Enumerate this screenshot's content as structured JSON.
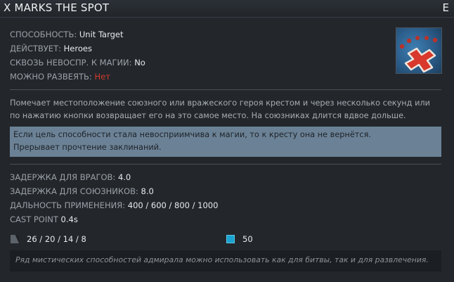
{
  "ability": {
    "title": "X MARKS THE SPOT",
    "hotkey": "E",
    "icon": "x-marks-the-spot-icon"
  },
  "stats": [
    {
      "label": "СПОСОБНОСТЬ: ",
      "value": "Unit Target"
    },
    {
      "label": "ДЕЙСТВУЕТ: ",
      "value": "Heroes"
    },
    {
      "label": "СКВОЗЬ НЕВОСПР. К МАГИИ: ",
      "value": "No"
    },
    {
      "label": "МОЖНО РАЗВЕЯТЬ: ",
      "value": "Нет"
    }
  ],
  "description": "Помечает местоположение союзного или вражеского героя крестом и через несколько секунд или по нажатию кнопки возвращает его на это самое место. На союзниках длится вдвое дольше.",
  "notes": [
    "Если цель способности стала невосприимчива к магии, то к кресту она не вернётся.",
    "Прерывает прочтение заклинаний."
  ],
  "values": [
    {
      "label": "ЗАДЕРЖКА ДЛЯ ВРАГОВ: ",
      "value": "4.0"
    },
    {
      "label": "ЗАДЕРЖКА ДЛЯ СОЮЗНИКОВ: ",
      "value": "8.0"
    },
    {
      "label": "ДАЛЬНОСТЬ ПРИМЕНЕНИЯ: ",
      "value": "400 / 600 / 800 / 1000"
    },
    {
      "label": "CAST POINT ",
      "value": "0.4s"
    }
  ],
  "costs": {
    "cooldown": "26 / 20 / 14 / 8",
    "mana": "50"
  },
  "lore": "Ряд мистических способностей адмирала можно использовать как для битвы, так и для развлечения.",
  "colors": {
    "no_dispel": "#d23a2a",
    "note_background": "#6b8296",
    "mana": "#1aa3d1"
  }
}
